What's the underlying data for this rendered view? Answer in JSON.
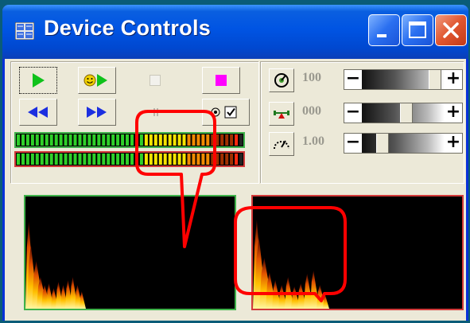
{
  "window": {
    "title": "Device Controls",
    "app_icon": "grid-app-icon",
    "caption_buttons": [
      "minimize-icon",
      "maximize-icon",
      "close-icon"
    ]
  },
  "transport": {
    "buttons": [
      {
        "icon": "play-icon",
        "state": "pressed"
      },
      {
        "icon": "smiley-play-icon",
        "state": "normal"
      },
      {
        "icon": "record-square-icon",
        "state": "normal"
      },
      {
        "icon": "rewind-icon",
        "state": "normal"
      },
      {
        "icon": "fast-forward-icon",
        "state": "normal"
      },
      {
        "icon": "radio-check-icon",
        "state": "normal"
      }
    ],
    "disabled_checkbox_1": false,
    "disabled_checkbox_2": false
  },
  "meters": [
    {
      "name": "top-level-meter",
      "level": 0.97,
      "border": "#3fb24a"
    },
    {
      "name": "bottom-level-meter",
      "level": 0.97,
      "border": "#d23a3a"
    }
  ],
  "controls": [
    {
      "icon": "dial-icon",
      "value": "100",
      "slider_level": 0.95
    },
    {
      "icon": "balance-icon",
      "value": "000",
      "slider_level": 0.55
    },
    {
      "icon": "speed-gauge-icon",
      "value": "1.00",
      "slider_level": 0.2
    }
  ],
  "visualizers": [
    {
      "name": "left-visualizer",
      "border": "#3fb24a"
    },
    {
      "name": "right-visualizer",
      "border": "#d23a3a"
    }
  ],
  "colors": {
    "titlebar": "#0054e3",
    "face": "#ece9d8",
    "annotation": "#ff0000",
    "meter_green": "#3fb24a",
    "meter_red": "#d23a3a",
    "record": "#ff00ff"
  }
}
